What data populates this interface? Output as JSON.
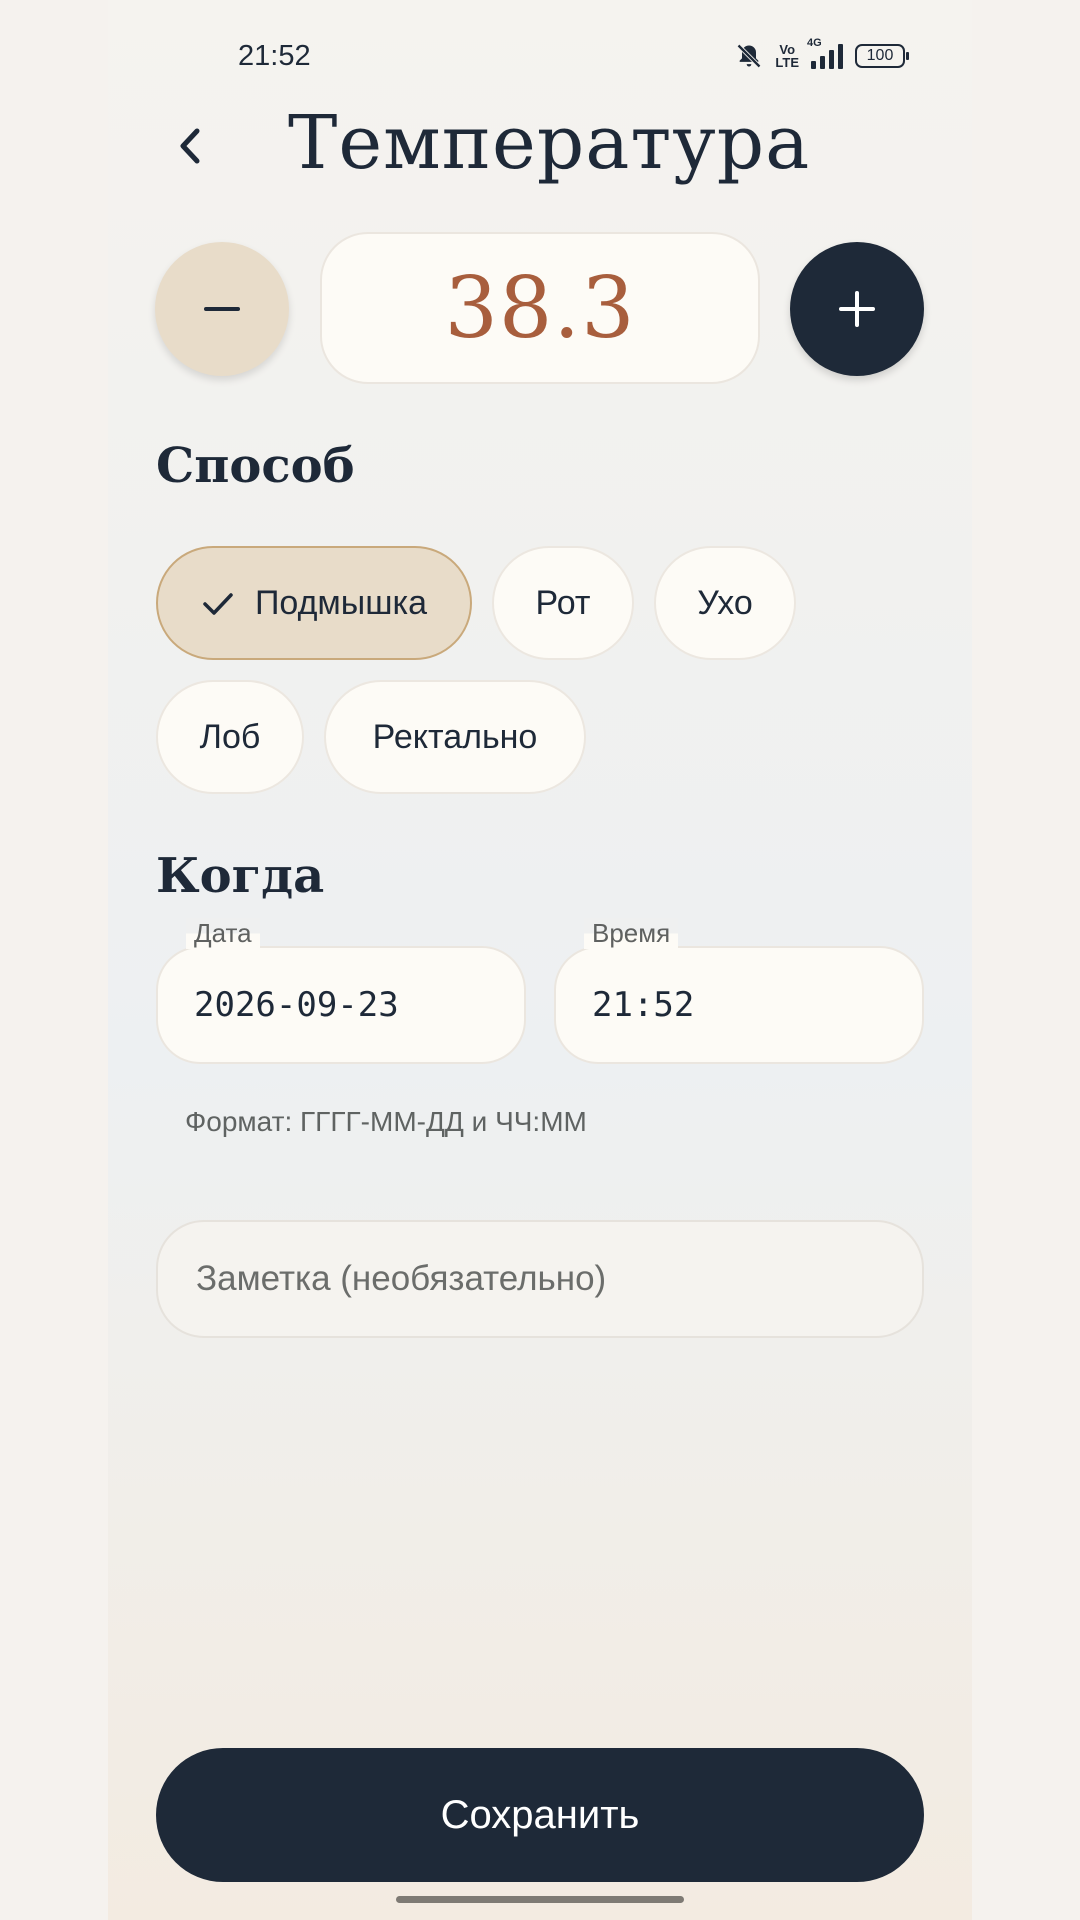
{
  "status_bar": {
    "time": "21:52",
    "network_label": "4G",
    "volte_label_top": "Vo",
    "volte_label_bottom": "LTE",
    "battery": "100",
    "icons": [
      "mute-icon",
      "volte-icon",
      "signal-icon",
      "battery-icon"
    ]
  },
  "header": {
    "title": "Температура",
    "back_icon": "chevron-left-icon"
  },
  "stepper": {
    "value": "38.3",
    "minus_icon": "minus-icon",
    "plus_icon": "plus-icon"
  },
  "method": {
    "title": "Способ",
    "options": [
      {
        "label": "Подмышка",
        "selected": true
      },
      {
        "label": "Рот",
        "selected": false
      },
      {
        "label": "Ухо",
        "selected": false
      },
      {
        "label": "Лоб",
        "selected": false
      },
      {
        "label": "Ректально",
        "selected": false
      }
    ]
  },
  "when": {
    "title": "Когда",
    "date_label": "Дата",
    "date_value": "2026-09-23",
    "time_label": "Время",
    "time_value": "21:52",
    "format_hint": "Формат: ГГГГ-ММ-ДД и ЧЧ:ММ"
  },
  "note": {
    "placeholder": "Заметка (необязательно)"
  },
  "save_label": "Сохранить",
  "colors": {
    "primary_dark": "#1e2938",
    "accent_value": "#a85e3d",
    "selected_chip": "#e8dcc9",
    "surface": "#fdfbf6"
  }
}
